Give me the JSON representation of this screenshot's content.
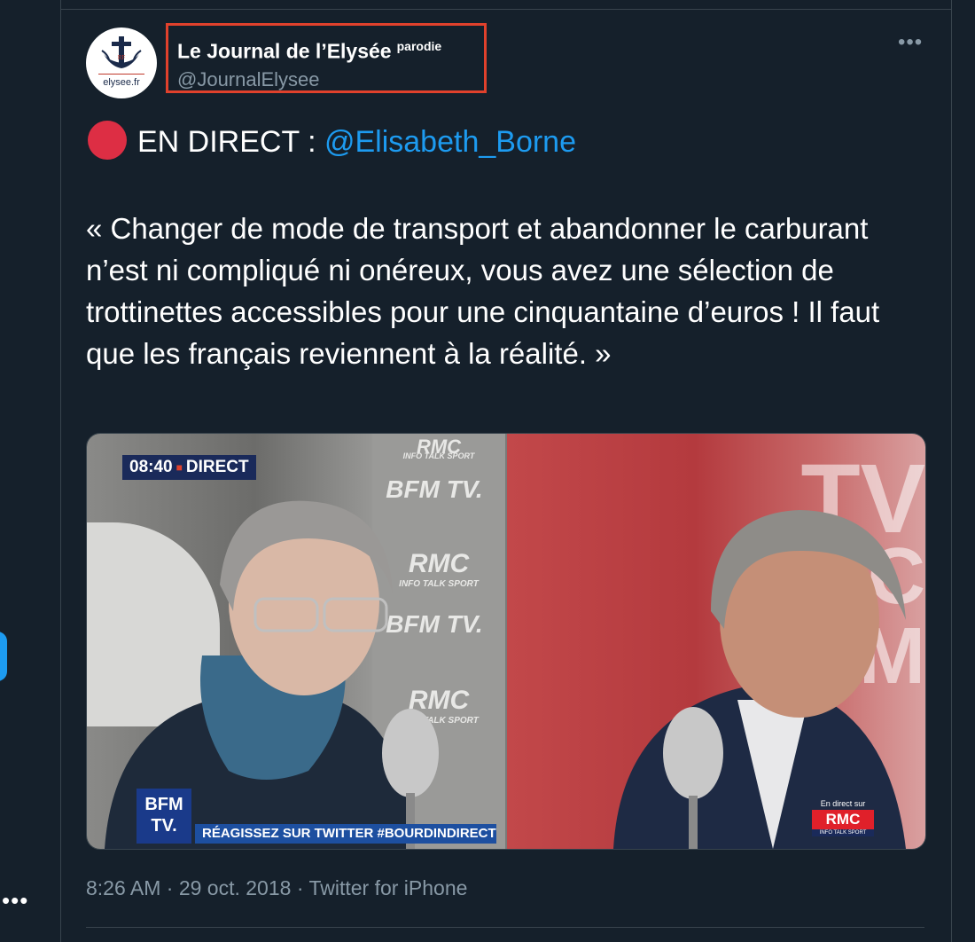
{
  "tweet": {
    "author": {
      "display_name": "Le Journal de l’Elysée",
      "parody_label": "parodie",
      "handle": "@JournalElysee",
      "avatar_caption": "elysee.fr"
    },
    "live_prefix": "EN DIRECT : ",
    "mention": "@Elisabeth_Borne",
    "quote": "« Changer de mode de transport et abandonner le carburant n’est ni compliqué ni onéreux, vous avez une sélection de trottinettes accessibles pour une cinquantaine d’euros ! Il faut que les français reviennent à la réalité. »",
    "media": {
      "time": "08:40",
      "live_label": "DIRECT",
      "backdrop_logos": [
        "RMC",
        "INFO TALK SPORT",
        "BFM TV.",
        "RMC",
        "INFO TALK SPORT",
        "BFM TV.",
        "RMC",
        "INFO TALK SPORT"
      ],
      "channel_badge": "BFM TV.",
      "ticker": "RÉAGISSEZ SUR TWITTER #BOURDINDIRECT",
      "rmc_caption": "En direct sur",
      "rmc_label": "RMC",
      "rmc_sub": "INFO TALK SPORT",
      "right_logos": [
        "TV",
        "RMC",
        "BFM"
      ]
    },
    "meta": "8:26 AM · 29 oct. 2018 · Twitter for iPhone"
  },
  "colors": {
    "background": "#15202b",
    "border": "#38444d",
    "secondary_text": "#8899a6",
    "link": "#1d9bf0",
    "highlight_box": "#e0412c",
    "live_dot": "#dd2e44"
  },
  "icons": {
    "more": "more-horizontal-icon",
    "live": "red-circle-icon"
  }
}
